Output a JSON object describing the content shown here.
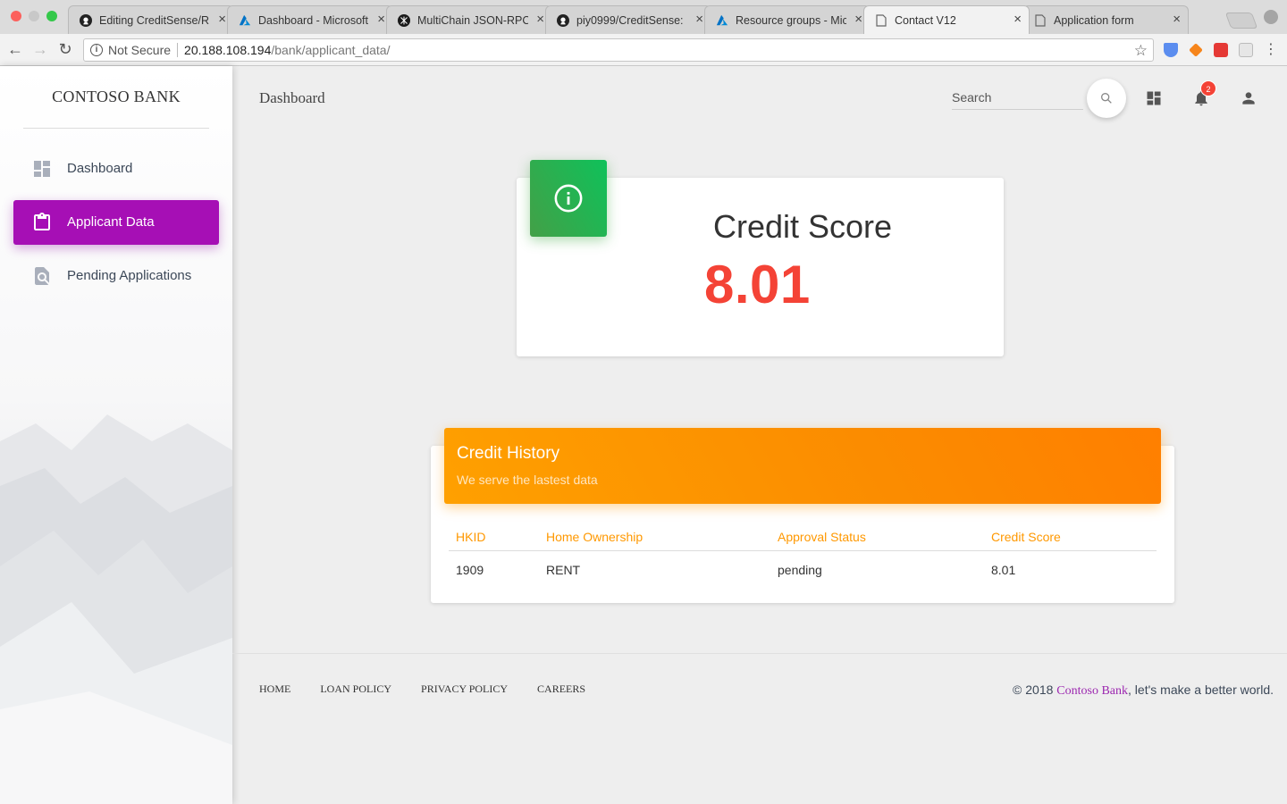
{
  "browser": {
    "tabs": [
      {
        "title": "Editing CreditSense/RE",
        "favicon": "github-icon"
      },
      {
        "title": "Dashboard - Microsoft",
        "favicon": "azure-icon"
      },
      {
        "title": "MultiChain JSON-RPC",
        "favicon": "multichain-icon"
      },
      {
        "title": "piy0999/CreditSense:",
        "favicon": "github-icon"
      },
      {
        "title": "Resource groups - Mic",
        "favicon": "azure-icon"
      },
      {
        "title": "Contact V12",
        "favicon": "page-icon",
        "active": true
      },
      {
        "title": "Application form",
        "favicon": "page-icon"
      }
    ],
    "security_label": "Not Secure",
    "url_host": "20.188.108.194",
    "url_path": "/bank/applicant_data/"
  },
  "sidebar": {
    "brand": "CONTOSO BANK",
    "items": [
      {
        "label": "Dashboard",
        "icon": "dashboard-icon"
      },
      {
        "label": "Applicant Data",
        "icon": "clipboard-icon",
        "active": true
      },
      {
        "label": "Pending Applications",
        "icon": "find-in-page-icon"
      }
    ]
  },
  "header": {
    "title": "Dashboard",
    "search_placeholder": "Search",
    "notification_count": "2"
  },
  "score_card": {
    "title": "Credit Score",
    "value": "8.01",
    "icon": "info-icon"
  },
  "history": {
    "title": "Credit History",
    "subtitle": "We serve the lastest data",
    "columns": [
      "HKID",
      "Home Ownership",
      "Approval Status",
      "Credit Score"
    ],
    "rows": [
      [
        "1909",
        "RENT",
        "pending",
        "8.01"
      ]
    ]
  },
  "footer": {
    "links": [
      "HOME",
      "LOAN POLICY",
      "PRIVACY POLICY",
      "CAREERS"
    ],
    "copyright_prefix": "© 2018 ",
    "copyright_brand": "Contoso Bank",
    "copyright_suffix": ", let's make a better world."
  },
  "colors": {
    "accent_purple": "#a60fb5",
    "score_red": "#f44336",
    "history_orange": "#ff9800",
    "success_green": "#43a047"
  }
}
